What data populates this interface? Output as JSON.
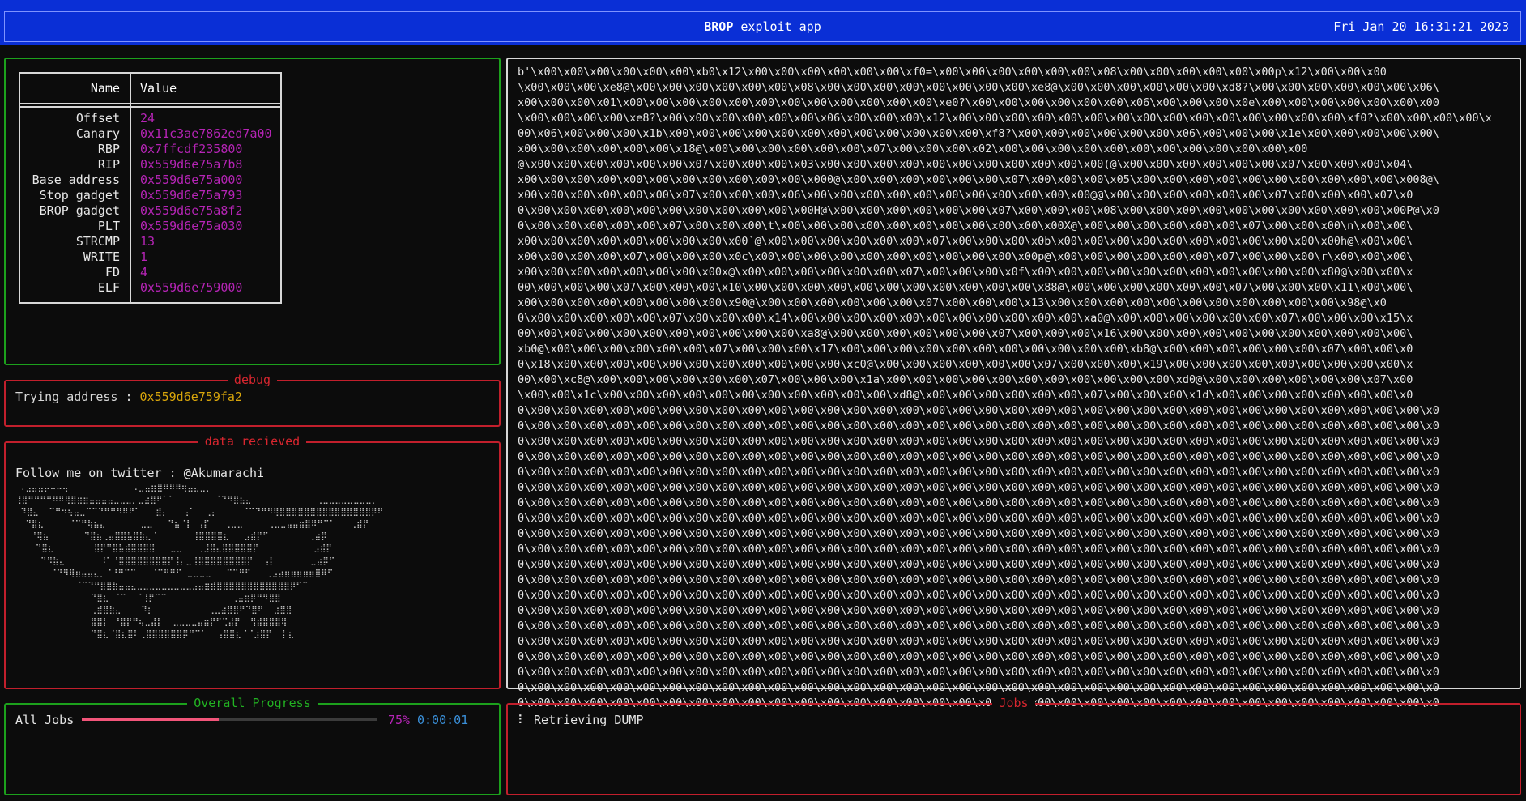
{
  "header": {
    "app_name": "BROP",
    "app_suffix": " exploit app",
    "clock": "Fri Jan 20 16:31:21 2023"
  },
  "info": {
    "col_name": "Name",
    "col_value": "Value",
    "rows": [
      {
        "name": "Offset",
        "value": "24"
      },
      {
        "name": "Canary",
        "value": "0x11c3ae7862ed7a00"
      },
      {
        "name": "RBP",
        "value": "0x7ffcdf235800"
      },
      {
        "name": "RIP",
        "value": "0x559d6e75a7b8"
      },
      {
        "name": "Base address",
        "value": "0x559d6e75a000"
      },
      {
        "name": "Stop gadget",
        "value": "0x559d6e75a793"
      },
      {
        "name": "BROP gadget",
        "value": "0x559d6e75a8f2"
      },
      {
        "name": "PLT",
        "value": "0x559d6e75a030"
      },
      {
        "name": "STRCMP",
        "value": "13"
      },
      {
        "name": "WRITE",
        "value": "1"
      },
      {
        "name": "FD",
        "value": "4"
      },
      {
        "name": "ELF",
        "value": "0x559d6e759000"
      }
    ]
  },
  "debug": {
    "title": "debug",
    "label": "Trying address : ",
    "address": "0x559d6e759fa2"
  },
  "received": {
    "title": "data recieved",
    "text": "Follow me on twitter : @Akumarachi",
    "ascii_art": " .⣠⣤⣤⡤⠤⠤⢤             .⣀⣤⣶⣿⠿⠿⠿⢶⣤⣄⣀⡀\n⢸⣿⠛⠛⠛⠛⠿⠿⢿⣿⣶⣶⣤⣤⣤⣤⣀⣀⣀⡀⣀⣴⣿⠟⠁⠁        ⠈⠙⠻⣿⣦⣄             ⢀⣀⣀⣀⣀⣀⣀⣀⣀⡀\n ⠹⣿⣄  ⠉⠛⠲⢦⣤⣀⠉⠉⠙⠛⠛⠻⠿⠟⠁   ⣾⡄   ⢠⠁  ⢀⡄     ⠈⠉⠙⠛⠻⢿⣿⣿⣿⣿⣿⣿⣿⣿⣿⣿⣿⣿⣿⣿⣿⡿⠟\n  ⠙⣿⣆     ⠈⠉⠛⢷⣦⣄       ⣀⣀   ⠙⣦⠈⡇ ⢠⡏   ⢀⣀⣀     ⢀⣀⣀⣤⣤⣶⣿⠿⠛⠉⠁   ⢀⣾⡟\n   ⠘⢿⣦       ⠙⣿⣦⢀⣤⣿⣿⣧⣿⣷⣄⠈       ⢸⣿⣿⣿⣿⣆   ⣠⣾⡟⠋        ⢀⣴⡿\n    ⠙⣿⣆        ⣿⡟⠛⣿⣧⣾⣿⣿⣿⣿   ⣀⣀   ⢀⣸⣿⣄⣿⣿⣿⣿⣿⡟           ⣠⣾⡟\n     ⠙⠻⣷⣄       ⠸⠁⠘⣿⣿⣿⣿⣿⣿⣿⣿⡟⢸⡄⣀⢸⣿⣿⣿⣿⣿⣿⣿⣿⡟  ⢠⡇       ⣀⣴⡿⠋\n       ⠈⠙⠻⢿⣶⣤⣤⣄⡀⠈⠘⠛⠉⠉   ⠈⠉⠛⠛⠋ ⣀⣀⣀⣀   ⠉⠉⠛⠋   ⢀⣠⣴⣶⣶⣶⣶⣶⣿⠿⠋\n            ⠈⠉⠙⠛⣿⣿⣷⣤⣤⣄⣀⣀⣀⣀⣀⣀⣀⣀⣀⣠⣤⣶⣾⣿⣿⣿⣿⣿⣿⣿⣿⣿⣿⣿⣿⡿⠋⠉\n               ⠙⣿⣆ ⠈⠉  ⠈⢸⡟⠉⠉             ⢀⣤⣶⡿⠛⠻⣿⣿\n               ⢀⣾⣿⣷⣄    ⠹⡆           ⢀⣀⣴⣿⣿⠟⠙⣿⠟  ⣰⣿⣿\n               ⣿⣿⡇ ⠘⣿⡟⠛⢦⣀⣼⡇  ⣀⣀⣀⣀⣤⣶⡟⠋⢉⣼⡟  ⢻⣾⣿⣿⣿⢿\n               ⠙⣿⣆⠈⣿⣆⣿⠇⢀⣿⣿⣿⣿⣿⣿⡿⠛⠉⠁  ⢠⣿⣿⣆⠈⠈⣰⣿⡟  ⡇⣆"
  },
  "dump": {
    "lines": [
      "b'\\x00\\x00\\x00\\x00\\x00\\x00\\xb0\\x12\\x00\\x00\\x00\\x00\\x00\\x00\\xf0=\\x00\\x00\\x00\\x00\\x00\\x00\\x08\\x00\\x00\\x00\\x00\\x00\\x00p\\x12\\x00\\x00\\x00",
      "\\x00\\x00\\x00\\xe8@\\x00\\x00\\x00\\x00\\x00\\x00\\x08\\x00\\x00\\x00\\x00\\x00\\x00\\x00\\x00\\xe8@\\x00\\x00\\x00\\x00\\x00\\x00\\xd8?\\x00\\x00\\x00\\x00\\x00\\x00\\x06\\",
      "x00\\x00\\x00\\x01\\x00\\x00\\x00\\x00\\x00\\x00\\x00\\x00\\x00\\x00\\x00\\x00\\xe0?\\x00\\x00\\x00\\x00\\x00\\x00\\x06\\x00\\x00\\x00\\x0e\\x00\\x00\\x00\\x00\\x00\\x00\\x00",
      "\\x00\\x00\\x00\\x00\\xe8?\\x00\\x00\\x00\\x00\\x00\\x00\\x06\\x00\\x00\\x00\\x12\\x00\\x00\\x00\\x00\\x00\\x00\\x00\\x00\\x00\\x00\\x00\\x00\\x00\\x00\\x00\\xf0?\\x00\\x00\\x00\\x00\\x",
      "00\\x06\\x00\\x00\\x00\\x1b\\x00\\x00\\x00\\x00\\x00\\x00\\x00\\x00\\x00\\x00\\x00\\x00\\xf8?\\x00\\x00\\x00\\x00\\x00\\x00\\x06\\x00\\x00\\x00\\x1e\\x00\\x00\\x00\\x00\\x00\\",
      "x00\\x00\\x00\\x00\\x00\\x00\\x18@\\x00\\x00\\x00\\x00\\x00\\x00\\x07\\x00\\x00\\x00\\x02\\x00\\x00\\x00\\x00\\x00\\x00\\x00\\x00\\x00\\x00\\x00\\x00",
      "@\\x00\\x00\\x00\\x00\\x00\\x00\\x07\\x00\\x00\\x00\\x03\\x00\\x00\\x00\\x00\\x00\\x00\\x00\\x00\\x00\\x00\\x00(@\\x00\\x00\\x00\\x00\\x00\\x00\\x07\\x00\\x00\\x00\\x04\\",
      "x00\\x00\\x00\\x00\\x00\\x00\\x00\\x00\\x00\\x00\\x00\\x000@\\x00\\x00\\x00\\x00\\x00\\x00\\x07\\x00\\x00\\x00\\x05\\x00\\x00\\x00\\x00\\x00\\x00\\x00\\x00\\x00\\x00\\x008@\\",
      "x00\\x00\\x00\\x00\\x00\\x00\\x07\\x00\\x00\\x00\\x06\\x00\\x00\\x00\\x00\\x00\\x00\\x00\\x00\\x00\\x00\\x00@@\\x00\\x00\\x00\\x00\\x00\\x00\\x07\\x00\\x00\\x00\\x07\\x0",
      "0\\x00\\x00\\x00\\x00\\x00\\x00\\x00\\x00\\x00\\x00\\x00H@\\x00\\x00\\x00\\x00\\x00\\x00\\x07\\x00\\x00\\x00\\x08\\x00\\x00\\x00\\x00\\x00\\x00\\x00\\x00\\x00\\x00\\x00P@\\x0",
      "0\\x00\\x00\\x00\\x00\\x00\\x07\\x00\\x00\\x00\\t\\x00\\x00\\x00\\x00\\x00\\x00\\x00\\x00\\x00\\x00\\x00X@\\x00\\x00\\x00\\x00\\x00\\x00\\x07\\x00\\x00\\x00\\n\\x00\\x00\\",
      "x00\\x00\\x00\\x00\\x00\\x00\\x00\\x00\\x00`@\\x00\\x00\\x00\\x00\\x00\\x00\\x07\\x00\\x00\\x00\\x0b\\x00\\x00\\x00\\x00\\x00\\x00\\x00\\x00\\x00\\x00\\x00h@\\x00\\x00\\",
      "x00\\x00\\x00\\x00\\x07\\x00\\x00\\x00\\x0c\\x00\\x00\\x00\\x00\\x00\\x00\\x00\\x00\\x00\\x00\\x00p@\\x00\\x00\\x00\\x00\\x00\\x00\\x07\\x00\\x00\\x00\\r\\x00\\x00\\x00\\",
      "x00\\x00\\x00\\x00\\x00\\x00\\x00\\x00x@\\x00\\x00\\x00\\x00\\x00\\x00\\x07\\x00\\x00\\x00\\x0f\\x00\\x00\\x00\\x00\\x00\\x00\\x00\\x00\\x00\\x00\\x00\\x80@\\x00\\x00\\x",
      "00\\x00\\x00\\x00\\x07\\x00\\x00\\x00\\x10\\x00\\x00\\x00\\x00\\x00\\x00\\x00\\x00\\x00\\x00\\x00\\x88@\\x00\\x00\\x00\\x00\\x00\\x00\\x07\\x00\\x00\\x00\\x11\\x00\\x00\\",
      "x00\\x00\\x00\\x00\\x00\\x00\\x00\\x00\\x90@\\x00\\x00\\x00\\x00\\x00\\x00\\x07\\x00\\x00\\x00\\x13\\x00\\x00\\x00\\x00\\x00\\x00\\x00\\x00\\x00\\x00\\x00\\x98@\\x0",
      "0\\x00\\x00\\x00\\x00\\x00\\x07\\x00\\x00\\x00\\x14\\x00\\x00\\x00\\x00\\x00\\x00\\x00\\x00\\x00\\x00\\x00\\xa0@\\x00\\x00\\x00\\x00\\x00\\x00\\x07\\x00\\x00\\x00\\x15\\x",
      "00\\x00\\x00\\x00\\x00\\x00\\x00\\x00\\x00\\x00\\x00\\xa8@\\x00\\x00\\x00\\x00\\x00\\x00\\x07\\x00\\x00\\x00\\x16\\x00\\x00\\x00\\x00\\x00\\x00\\x00\\x00\\x00\\x00\\x00\\",
      "xb0@\\x00\\x00\\x00\\x00\\x00\\x00\\x07\\x00\\x00\\x00\\x17\\x00\\x00\\x00\\x00\\x00\\x00\\x00\\x00\\x00\\x00\\x00\\xb8@\\x00\\x00\\x00\\x00\\x00\\x00\\x07\\x00\\x00\\x0",
      "0\\x18\\x00\\x00\\x00\\x00\\x00\\x00\\x00\\x00\\x00\\x00\\x00\\xc0@\\x00\\x00\\x00\\x00\\x00\\x00\\x07\\x00\\x00\\x00\\x19\\x00\\x00\\x00\\x00\\x00\\x00\\x00\\x00\\x00\\x",
      "00\\x00\\xc8@\\x00\\x00\\x00\\x00\\x00\\x00\\x07\\x00\\x00\\x00\\x1a\\x00\\x00\\x00\\x00\\x00\\x00\\x00\\x00\\x00\\x00\\x00\\xd0@\\x00\\x00\\x00\\x00\\x00\\x00\\x07\\x00",
      "\\x00\\x00\\x1c\\x00\\x00\\x00\\x00\\x00\\x00\\x00\\x00\\x00\\x00\\x00\\xd8@\\x00\\x00\\x00\\x00\\x00\\x00\\x07\\x00\\x00\\x00\\x1d\\x00\\x00\\x00\\x00\\x00\\x00\\x00\\x0",
      "0\\x00\\x00\\x00\\x00\\x00\\x00\\x00\\x00\\x00\\x00\\x00\\x00\\x00\\x00\\x00\\x00\\x00\\x00\\x00\\x00\\x00\\x00\\x00\\x00\\x00\\x00\\x00\\x00\\x00\\x00\\x00\\x00\\x00\\x00\\x0",
      "0\\x00\\x00\\x00\\x00\\x00\\x00\\x00\\x00\\x00\\x00\\x00\\x00\\x00\\x00\\x00\\x00\\x00\\x00\\x00\\x00\\x00\\x00\\x00\\x00\\x00\\x00\\x00\\x00\\x00\\x00\\x00\\x00\\x00\\x00\\x0",
      "0\\x00\\x00\\x00\\x00\\x00\\x00\\x00\\x00\\x00\\x00\\x00\\x00\\x00\\x00\\x00\\x00\\x00\\x00\\x00\\x00\\x00\\x00\\x00\\x00\\x00\\x00\\x00\\x00\\x00\\x00\\x00\\x00\\x00\\x00\\x0",
      "0\\x00\\x00\\x00\\x00\\x00\\x00\\x00\\x00\\x00\\x00\\x00\\x00\\x00\\x00\\x00\\x00\\x00\\x00\\x00\\x00\\x00\\x00\\x00\\x00\\x00\\x00\\x00\\x00\\x00\\x00\\x00\\x00\\x00\\x00\\x0",
      "0\\x00\\x00\\x00\\x00\\x00\\x00\\x00\\x00\\x00\\x00\\x00\\x00\\x00\\x00\\x00\\x00\\x00\\x00\\x00\\x00\\x00\\x00\\x00\\x00\\x00\\x00\\x00\\x00\\x00\\x00\\x00\\x00\\x00\\x00\\x0",
      "0\\x00\\x00\\x00\\x00\\x00\\x00\\x00\\x00\\x00\\x00\\x00\\x00\\x00\\x00\\x00\\x00\\x00\\x00\\x00\\x00\\x00\\x00\\x00\\x00\\x00\\x00\\x00\\x00\\x00\\x00\\x00\\x00\\x00\\x00\\x0",
      "0\\x00\\x00\\x00\\x00\\x00\\x00\\x00\\x00\\x00\\x00\\x00\\x00\\x00\\x00\\x00\\x00\\x00\\x00\\x00\\x00\\x00\\x00\\x00\\x00\\x00\\x00\\x00\\x00\\x00\\x00\\x00\\x00\\x00\\x00\\x0",
      "0\\x00\\x00\\x00\\x00\\x00\\x00\\x00\\x00\\x00\\x00\\x00\\x00\\x00\\x00\\x00\\x00\\x00\\x00\\x00\\x00\\x00\\x00\\x00\\x00\\x00\\x00\\x00\\x00\\x00\\x00\\x00\\x00\\x00\\x00\\x0",
      "0\\x00\\x00\\x00\\x00\\x00\\x00\\x00\\x00\\x00\\x00\\x00\\x00\\x00\\x00\\x00\\x00\\x00\\x00\\x00\\x00\\x00\\x00\\x00\\x00\\x00\\x00\\x00\\x00\\x00\\x00\\x00\\x00\\x00\\x00\\x0",
      "0\\x00\\x00\\x00\\x00\\x00\\x00\\x00\\x00\\x00\\x00\\x00\\x00\\x00\\x00\\x00\\x00\\x00\\x00\\x00\\x00\\x00\\x00\\x00\\x00\\x00\\x00\\x00\\x00\\x00\\x00\\x00\\x00\\x00\\x00\\x0",
      "0\\x00\\x00\\x00\\x00\\x00\\x00\\x00\\x00\\x00\\x00\\x00\\x00\\x00\\x00\\x00\\x00\\x00\\x00\\x00\\x00\\x00\\x00\\x00\\x00\\x00\\x00\\x00\\x00\\x00\\x00\\x00\\x00\\x00\\x00\\x0",
      "0\\x00\\x00\\x00\\x00\\x00\\x00\\x00\\x00\\x00\\x00\\x00\\x00\\x00\\x00\\x00\\x00\\x00\\x00\\x00\\x00\\x00\\x00\\x00\\x00\\x00\\x00\\x00\\x00\\x00\\x00\\x00\\x00\\x00\\x00\\x0",
      "0\\x00\\x00\\x00\\x00\\x00\\x00\\x00\\x00\\x00\\x00\\x00\\x00\\x00\\x00\\x00\\x00\\x00\\x00\\x00\\x00\\x00\\x00\\x00\\x00\\x00\\x00\\x00\\x00\\x00\\x00\\x00\\x00\\x00\\x00\\x0",
      "0\\x00\\x00\\x00\\x00\\x00\\x00\\x00\\x00\\x00\\x00\\x00\\x00\\x00\\x00\\x00\\x00\\x00\\x00\\x00\\x00\\x00\\x00\\x00\\x00\\x00\\x00\\x00\\x00\\x00\\x00\\x00\\x00\\x00\\x00\\x0",
      "0\\x00\\x00\\x00\\x00\\x00\\x00\\x00\\x00\\x00\\x00\\x00\\x00\\x00\\x00\\x00\\x00\\x00\\x00\\x00\\x00\\x00\\x00\\x00\\x00\\x00\\x00\\x00\\x00\\x00\\x00\\x00\\x00\\x00\\x00\\x0",
      "0\\x00\\x00\\x00\\x00\\x00\\x00\\x00\\x00\\x00\\x00\\x00\\x00\\x00\\x00\\x00\\x00\\x00\\x00\\x00\\x00\\x00\\x00\\x00\\x00\\x00\\x00\\x00\\x00\\x00\\x00\\x00\\x00\\x00\\x00\\x0",
      "0\\x00\\x00\\x00\\x00\\x00\\x00\\x00\\x00\\x00\\x00\\x00\\x00\\x00\\x00\\x00\\x00\\x00\\x00\\x00\\x00\\x00\\x00\\x00\\x00\\x00\\x00\\x00\\x00\\x00\\x00\\x00\\x00\\x00\\x00\\x0",
      "0\\x00\\x00\\x00\\x00\\x00\\x00\\x00\\x00\\x00\\x00\\x00\\x00\\x00\\x00\\x00\\x00\\x00\\x00\\x00\\x00\\x00\\x00\\x00\\x00\\x00\\x00\\x00\\x00\\x00\\x00\\x00\\x00\\x00\\x00\\x0",
      "0\\x00\\x00\\x00\\x00\\x00\\x00\\x00\\x00\\x00\\x00\\x00\\x00\\x00\\x00\\x00\\x00\\x00\\x00\\x00\\x00\\x00\\x00\\x00\\x00\\x00\\x00\\x00\\x00\\x00\\x00\\x00\\x00\\x00\\x00\\x0",
      "0\\x00\\x00\\x00\\x00\\x00\\x00\\x00\\x00\\x00\\x00\\x00\\x00\\x00\\x00\\x00\\x00\\x00\\x00\\x00\\x00\\x00\\x00\\x00\\x00\\x00\\x00\\x00\\x00\\x00\\x00\\x00\\x00\\x00\\x00\\x0"
    ]
  },
  "progress": {
    "title": "Overall Progress",
    "label": "All Jobs",
    "fraction": 0.75,
    "percent": "75%",
    "elapsed": "0:00:01"
  },
  "jobs": {
    "title": "Jobs",
    "spinner": "⠇",
    "items": [
      "Retrieving DUMP"
    ]
  },
  "colors": {
    "header_bg": "#0a2fd6",
    "value_purple": "#b524b5",
    "address_yellow": "#d9a60b",
    "border_red": "#c21f2c",
    "border_green": "#1ca11c",
    "progress_pink": "#f2557a",
    "time_blue": "#3a8fd8"
  }
}
